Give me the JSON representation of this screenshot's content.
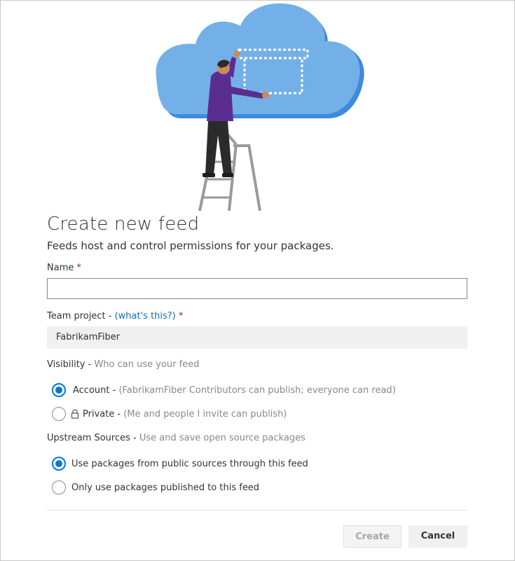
{
  "dialog": {
    "title": "Create new feed",
    "subtitle": "Feeds host and control permissions for your packages."
  },
  "name_field": {
    "label": "Name",
    "required_mark": "*",
    "value": ""
  },
  "team_project": {
    "label": "Team project - ",
    "help_link": "(what's this?)",
    "required_mark": "*",
    "value": "FabrikamFiber"
  },
  "visibility": {
    "label": "Visibility - ",
    "hint": "Who can use your feed",
    "options": [
      {
        "label": "Account - ",
        "detail": "(FabrikamFiber Contributors can publish; everyone can read)",
        "selected": true
      },
      {
        "label": "Private - ",
        "detail": "(Me and people I invite can publish)",
        "selected": false,
        "icon": "lock-icon"
      }
    ]
  },
  "upstream": {
    "label": "Upstream Sources - ",
    "hint": "Use and save open source packages",
    "options": [
      {
        "label": "Use packages from public sources through this feed",
        "selected": true
      },
      {
        "label": "Only use packages published to this feed",
        "selected": false
      }
    ]
  },
  "buttons": {
    "create": "Create",
    "cancel": "Cancel"
  },
  "colors": {
    "accent": "#0078d4",
    "cloud": "#6fb0e8",
    "shirt": "#5c2d91"
  }
}
